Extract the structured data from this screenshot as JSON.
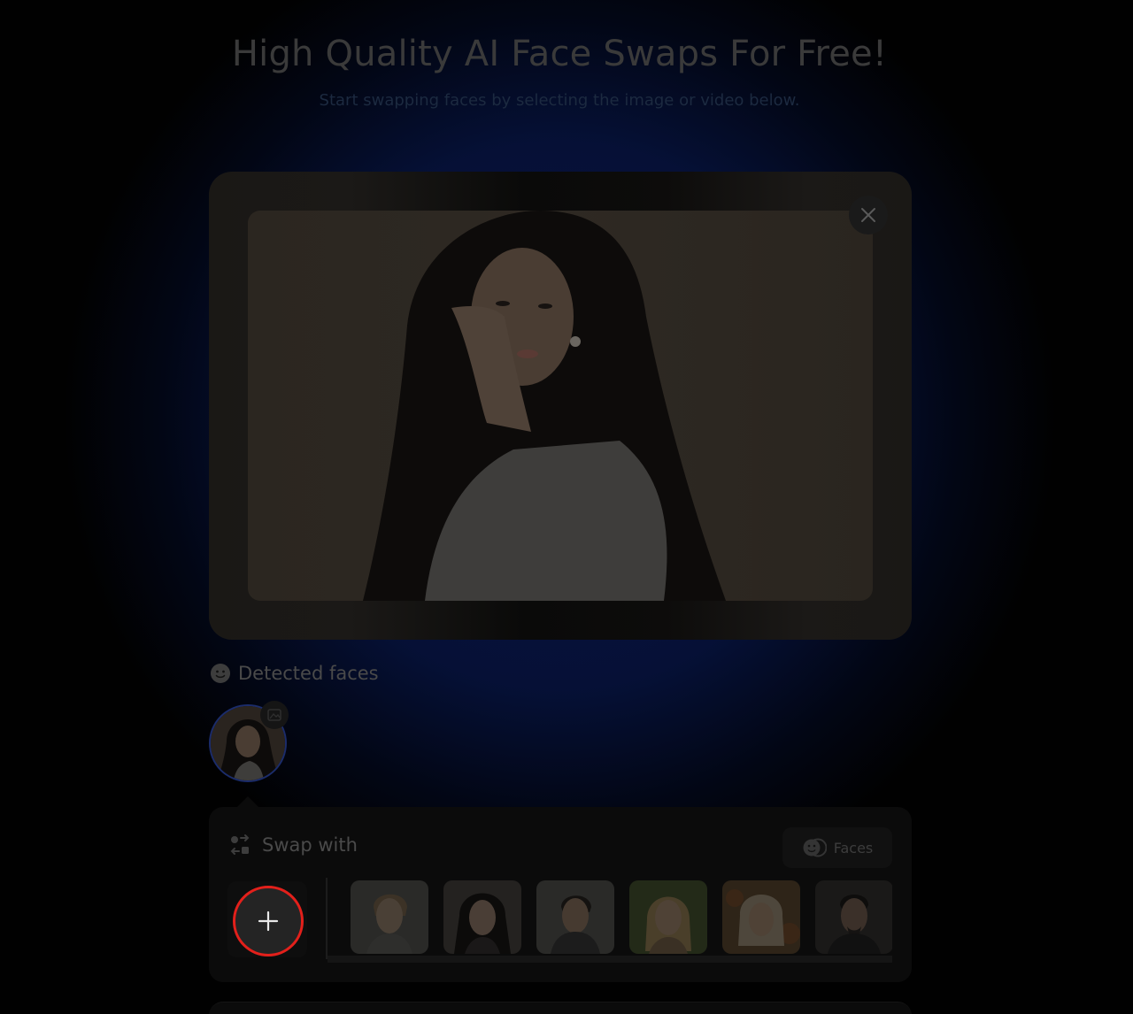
{
  "header": {
    "title": "High Quality AI Face Swaps For Free!",
    "subtitle": "Start swapping faces by selecting the image or video below."
  },
  "preview": {
    "close_icon": "close-icon"
  },
  "detected_faces": {
    "label": "Detected faces",
    "icon": "smiley-icon",
    "badge_icon": "edit-image-icon",
    "count": 1
  },
  "swap_panel": {
    "title": "Swap with",
    "icon": "swap-arrows-icon",
    "faces_button_label": "Faces",
    "faces_button_icon": "faces-icon",
    "add_icon": "plus-icon",
    "face_options": [
      {
        "name": "face-option-1",
        "tone": "#3a3a36"
      },
      {
        "name": "face-option-2",
        "tone": "#2a2624"
      },
      {
        "name": "face-option-3",
        "tone": "#2c2c2a"
      },
      {
        "name": "face-option-4",
        "tone": "#2f3324"
      },
      {
        "name": "face-option-5",
        "tone": "#3a2a1f"
      },
      {
        "name": "face-option-6",
        "tone": "#1f1c1a"
      }
    ]
  },
  "colors": {
    "accent_highlight": "#e3201b",
    "face_ring": "#1b2c6b"
  }
}
